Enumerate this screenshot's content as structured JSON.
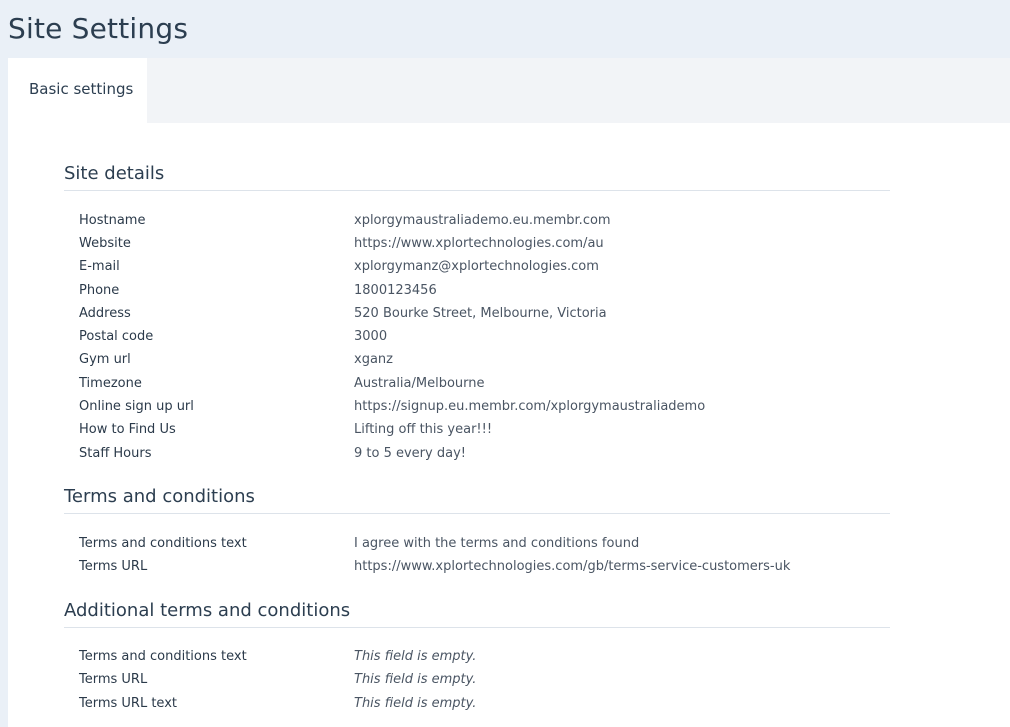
{
  "page": {
    "title": "Site Settings"
  },
  "tabs": [
    {
      "label": "Basic settings",
      "active": true
    }
  ],
  "sections": {
    "site_details": {
      "title": "Site details",
      "rows": [
        {
          "label": "Hostname",
          "value": "xplorgymaustraliademo.eu.membr.com"
        },
        {
          "label": "Website",
          "value": "https://www.xplortechnologies.com/au"
        },
        {
          "label": "E-mail",
          "value": "xplorgymanz@xplortechnologies.com"
        },
        {
          "label": "Phone",
          "value": "1800123456"
        },
        {
          "label": "Address",
          "value": "520 Bourke Street, Melbourne, Victoria"
        },
        {
          "label": "Postal code",
          "value": "3000"
        },
        {
          "label": "Gym url",
          "value": "xganz"
        },
        {
          "label": "Timezone",
          "value": "Australia/Melbourne"
        },
        {
          "label": "Online sign up url",
          "value": "https://signup.eu.membr.com/xplorgymaustraliademo"
        },
        {
          "label": "How to Find Us",
          "value": "Lifting off this year!!!"
        },
        {
          "label": "Staff Hours",
          "value": "9 to 5 every day!"
        }
      ]
    },
    "terms": {
      "title": "Terms and conditions",
      "rows": [
        {
          "label": "Terms and conditions text",
          "value": "I agree with the terms and conditions found"
        },
        {
          "label": "Terms URL",
          "value": "https://www.xplortechnologies.com/gb/terms-service-customers-uk"
        }
      ]
    },
    "additional_terms": {
      "title": "Additional terms and conditions",
      "rows": [
        {
          "label": "Terms and conditions text",
          "value": "This field is empty."
        },
        {
          "label": "Terms URL",
          "value": "This field is empty."
        },
        {
          "label": "Terms URL text",
          "value": "This field is empty."
        }
      ]
    }
  },
  "colors": {
    "page_background": "#eaf0f7",
    "panel_background": "#ffffff",
    "tabbar_background": "#f2f4f7",
    "text_primary": "#2c3e50",
    "divider": "#dde3ea"
  }
}
